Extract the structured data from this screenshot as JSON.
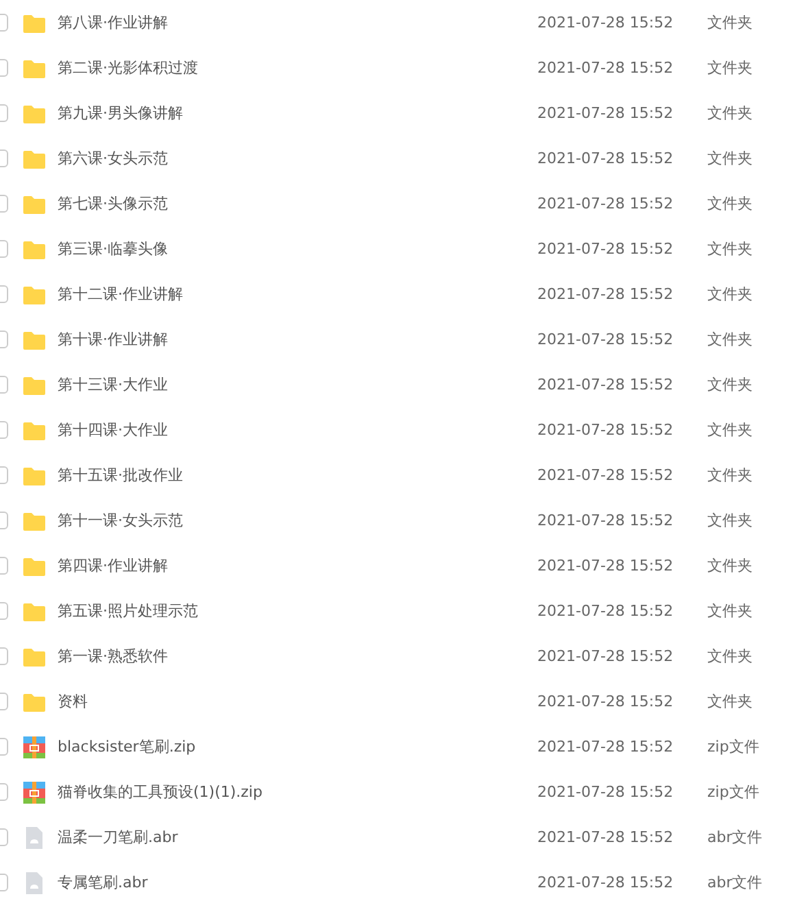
{
  "files": [
    {
      "kind": "folder",
      "name": "第八课·作业讲解",
      "modified": "2021-07-28 15:52",
      "type": "文件夹",
      "checked": false
    },
    {
      "kind": "folder",
      "name": "第二课·光影体积过渡",
      "modified": "2021-07-28 15:52",
      "type": "文件夹",
      "checked": false
    },
    {
      "kind": "folder",
      "name": "第九课·男头像讲解",
      "modified": "2021-07-28 15:52",
      "type": "文件夹",
      "checked": false
    },
    {
      "kind": "folder",
      "name": "第六课·女头示范",
      "modified": "2021-07-28 15:52",
      "type": "文件夹",
      "checked": false
    },
    {
      "kind": "folder",
      "name": "第七课·头像示范",
      "modified": "2021-07-28 15:52",
      "type": "文件夹",
      "checked": false
    },
    {
      "kind": "folder",
      "name": "第三课·临摹头像",
      "modified": "2021-07-28 15:52",
      "type": "文件夹",
      "checked": false
    },
    {
      "kind": "folder",
      "name": "第十二课·作业讲解",
      "modified": "2021-07-28 15:52",
      "type": "文件夹",
      "checked": false
    },
    {
      "kind": "folder",
      "name": "第十课·作业讲解",
      "modified": "2021-07-28 15:52",
      "type": "文件夹",
      "checked": false
    },
    {
      "kind": "folder",
      "name": "第十三课·大作业",
      "modified": "2021-07-28 15:52",
      "type": "文件夹",
      "checked": false
    },
    {
      "kind": "folder",
      "name": "第十四课·大作业",
      "modified": "2021-07-28 15:52",
      "type": "文件夹",
      "checked": false
    },
    {
      "kind": "folder",
      "name": "第十五课·批改作业",
      "modified": "2021-07-28 15:52",
      "type": "文件夹",
      "checked": false
    },
    {
      "kind": "folder",
      "name": "第十一课·女头示范",
      "modified": "2021-07-28 15:52",
      "type": "文件夹",
      "checked": false
    },
    {
      "kind": "folder",
      "name": "第四课·作业讲解",
      "modified": "2021-07-28 15:52",
      "type": "文件夹",
      "checked": false
    },
    {
      "kind": "folder",
      "name": "第五课·照片处理示范",
      "modified": "2021-07-28 15:52",
      "type": "文件夹",
      "checked": false
    },
    {
      "kind": "folder",
      "name": "第一课·熟悉软件",
      "modified": "2021-07-28 15:52",
      "type": "文件夹",
      "checked": false
    },
    {
      "kind": "folder",
      "name": "资料",
      "modified": "2021-07-28 15:52",
      "type": "文件夹",
      "checked": false
    },
    {
      "kind": "zip",
      "name": "blacksister笔刷.zip",
      "modified": "2021-07-28 15:52",
      "type": "zip文件",
      "checked": false
    },
    {
      "kind": "zip",
      "name": "猫脊收集的工具预设(1)(1).zip",
      "modified": "2021-07-28 15:52",
      "type": "zip文件",
      "checked": false
    },
    {
      "kind": "file",
      "name": "温柔一刀笔刷.abr",
      "modified": "2021-07-28 15:52",
      "type": "abr文件",
      "checked": false
    },
    {
      "kind": "file",
      "name": "专属笔刷.abr",
      "modified": "2021-07-28 15:52",
      "type": "abr文件",
      "checked": false
    }
  ]
}
